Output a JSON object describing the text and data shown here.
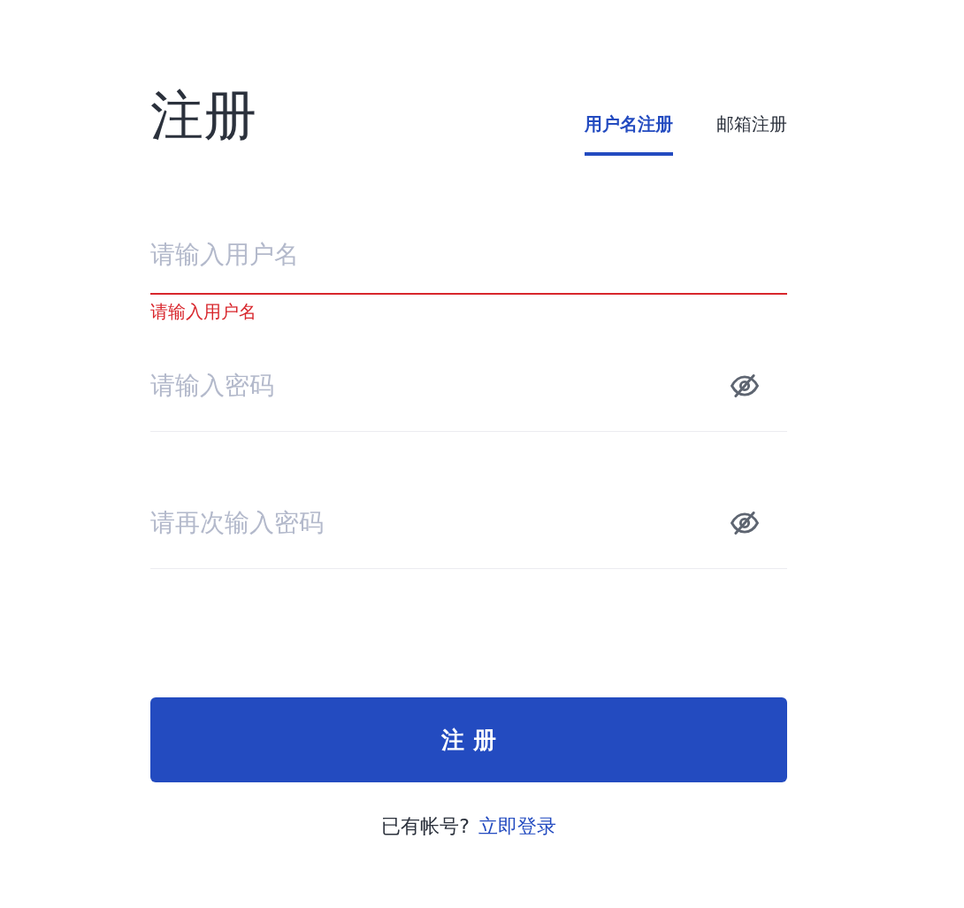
{
  "title": "注册",
  "tabs": [
    {
      "label": "用户名注册",
      "selected": true
    },
    {
      "label": "邮箱注册",
      "selected": false
    }
  ],
  "fields": [
    {
      "kind": "text",
      "placeholder": "请输入用户名",
      "error": "请输入用户名"
    },
    {
      "kind": "password",
      "placeholder": "请输入密码"
    },
    {
      "kind": "password",
      "placeholder": "请再次输入密码"
    }
  ],
  "submit": {
    "label": "注 册"
  },
  "footer": {
    "text": "已有帐号?",
    "link": "立即登录"
  }
}
